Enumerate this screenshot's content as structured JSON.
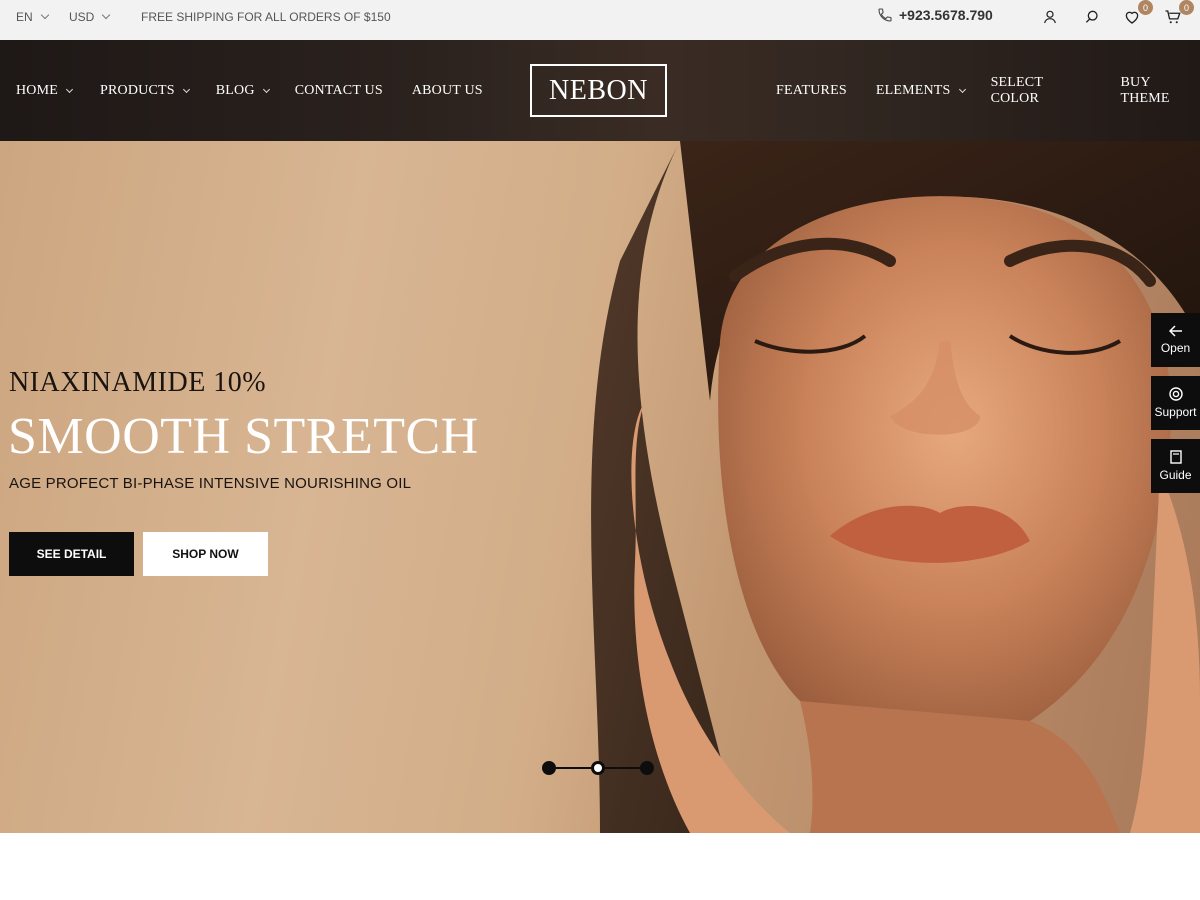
{
  "topbar": {
    "language": "EN",
    "currency": "USD",
    "promo": "FREE SHIPPING FOR ALL ORDERS OF $150",
    "phone": "+923.5678.790",
    "wishlist_count": "0",
    "cart_count": "0",
    "icons": [
      "phone-icon",
      "user-icon",
      "search-icon",
      "heart-icon",
      "cart-icon"
    ]
  },
  "header": {
    "logo": "NEBON",
    "nav_left": [
      {
        "label": "HOME",
        "dropdown": true
      },
      {
        "label": "PRODUCTS",
        "dropdown": true
      },
      {
        "label": "BLOG",
        "dropdown": true
      },
      {
        "label": "CONTACT US",
        "dropdown": false
      },
      {
        "label": "ABOUT US",
        "dropdown": false
      }
    ],
    "nav_right": [
      {
        "label": "FEATURES",
        "dropdown": false
      },
      {
        "label": "ELEMENTS",
        "dropdown": true
      },
      {
        "label": "SELECT COLOR",
        "dropdown": false
      },
      {
        "label": "BUY THEME",
        "dropdown": false
      }
    ]
  },
  "hero": {
    "eyebrow": "NIAXINAMIDE 10%",
    "title": "SMOOTH STRETCH",
    "subtitle": "AGE PROFECT BI-PHASE INTENSIVE NOURISHING OIL",
    "primary_button": "SEE DETAIL",
    "secondary_button": "SHOP NOW",
    "slides_total": 3,
    "active_slide": 2
  },
  "side_panel": [
    {
      "label": "Open",
      "icon": "arrow-left-icon"
    },
    {
      "label": "Support",
      "icon": "lifebuoy-icon"
    },
    {
      "label": "Guide",
      "icon": "book-icon"
    }
  ],
  "colors": {
    "accent": "#b08561",
    "dark": "#0d0d0d",
    "header_bg": "#2b221e",
    "hero_bg": "#d8b593"
  }
}
